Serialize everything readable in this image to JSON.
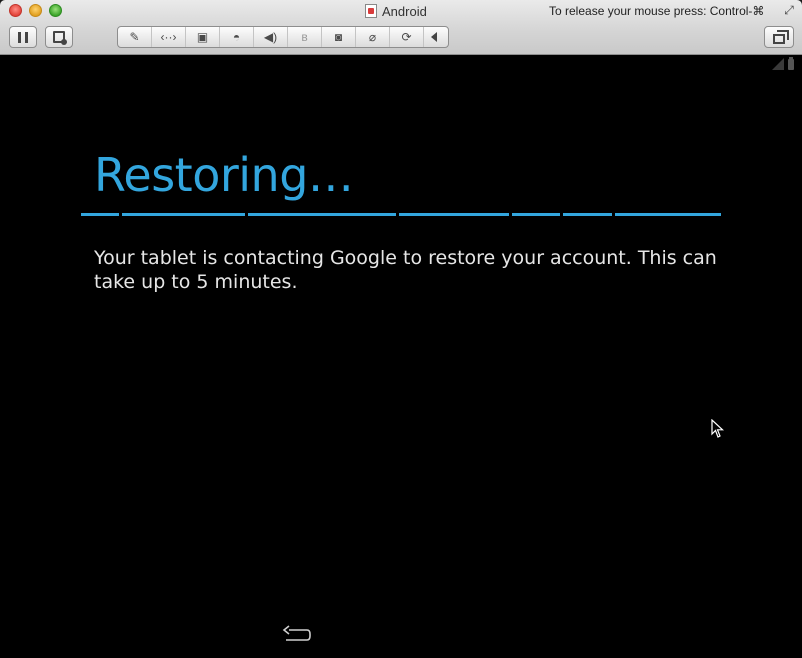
{
  "window": {
    "title": "Android",
    "release_hint": "To release your mouse press: Control-⌘"
  },
  "toolbar": {
    "devices": [
      {
        "icon": "wrench-icon",
        "glyph": "🔧"
      },
      {
        "icon": "network-icon",
        "glyph": "‹··›"
      },
      {
        "icon": "disk-icon",
        "glyph": "▣"
      },
      {
        "icon": "cd-icon",
        "glyph": "◓"
      },
      {
        "icon": "sound-icon",
        "glyph": "🔊"
      },
      {
        "icon": "bluetooth-icon",
        "glyph": "ʙ"
      },
      {
        "icon": "camera-icon",
        "glyph": "◙"
      },
      {
        "icon": "usb-icon",
        "glyph": "⌀"
      },
      {
        "icon": "shared-folder-icon",
        "glyph": "⟳"
      }
    ]
  },
  "android": {
    "heading": "Restoring…",
    "message": "Your tablet is contacting Google to restore your account. This can take up to 5 minutes.",
    "accent_color": "#33a6de"
  }
}
